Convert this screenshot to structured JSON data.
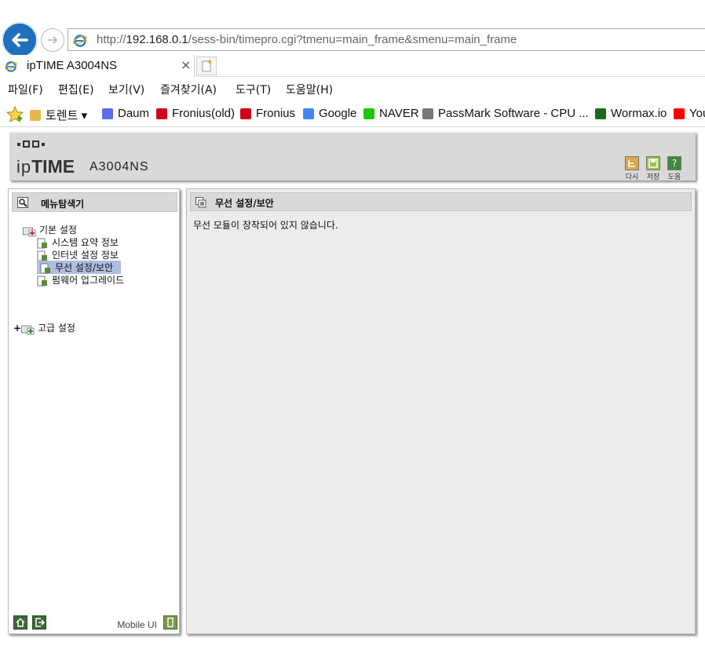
{
  "browser": {
    "address_prefix": "http://",
    "address_host": "192.168.0.1",
    "address_path": "/sess-bin/timepro.cgi?tmenu=main_frame&smenu=main_frame",
    "tab_title": "ipTIME A3004NS",
    "tab_close": "×",
    "menu": [
      "파일(F)",
      "편집(E)",
      "보기(V)",
      "즐겨찾기(A)",
      "도구(T)",
      "도움말(H)"
    ],
    "favorites": [
      {
        "label": "토렌트 ▾",
        "icon": "folder-icon",
        "color": "#e8b84a"
      },
      {
        "label": "Daum",
        "icon": "daum-icon",
        "color": "#5b6ee8"
      },
      {
        "label": "Fronius(old)",
        "icon": "fronius-icon",
        "color": "#d0021b"
      },
      {
        "label": "Fronius",
        "icon": "fronius-icon",
        "color": "#d0021b"
      },
      {
        "label": "Google",
        "icon": "google-icon",
        "color": "#4285f4"
      },
      {
        "label": "NAVER",
        "icon": "naver-icon",
        "color": "#1ec800"
      },
      {
        "label": "PassMark Software - CPU ...",
        "icon": "passmark-icon",
        "color": "#777777"
      },
      {
        "label": "Wormax.io",
        "icon": "wormax-icon",
        "color": "#1a6b1a"
      },
      {
        "label": "You",
        "icon": "youtube-icon",
        "color": "#ff0000"
      }
    ]
  },
  "router": {
    "logo_prefix": "ip",
    "logo_bold": "TIME",
    "model": "A3004NS",
    "header_buttons": [
      {
        "label": "다시",
        "icon": "back-icon",
        "color": "#d9a94a"
      },
      {
        "label": "저장",
        "icon": "save-icon",
        "color": "#9ac24a"
      },
      {
        "label": "도움",
        "icon": "help-icon",
        "color": "#3f8a3a",
        "glyph": "?"
      }
    ],
    "menu_title": "메뉴탐색기",
    "basic_group": "기본 설정",
    "basic_items": [
      "시스템 요약 정보",
      "인터넷 설정 정보",
      "무선 설정/보안",
      "펌웨어 업그레이드"
    ],
    "selected_index": 2,
    "advanced_group": "고급 설정",
    "advanced_toggle": "+",
    "mobile_label": "Mobile UI",
    "content_title": "무선 설정/보안",
    "content_message": "무선 모듈이 장착되어 있지 않습니다."
  }
}
